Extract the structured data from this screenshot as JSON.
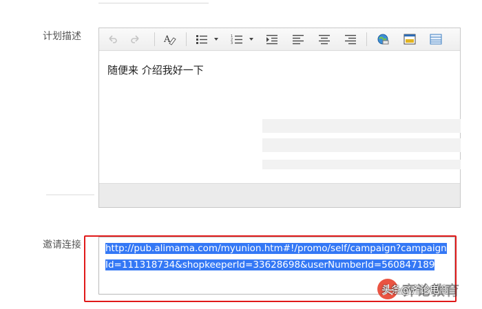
{
  "form": {
    "plan_description_label": "计划描述",
    "invite_link_label": "邀请连接"
  },
  "editor": {
    "toolbar": [
      {
        "name": "undo-icon"
      },
      {
        "name": "redo-icon"
      },
      {
        "name": "clear-format-icon"
      },
      {
        "name": "bulleted-list-icon"
      },
      {
        "name": "numbered-list-icon"
      },
      {
        "name": "indent-icon"
      },
      {
        "name": "align-left-icon"
      },
      {
        "name": "align-center-icon"
      },
      {
        "name": "align-right-icon"
      },
      {
        "name": "insert-link-icon"
      },
      {
        "name": "insert-image-icon"
      },
      {
        "name": "insert-table-icon"
      }
    ],
    "content": "随便来 介绍我好一下"
  },
  "invite": {
    "url": "http://pub.alimama.com/myunion.htm#!/promo/self/campaign?campaignId=111318734&shopkeeperId=33628698&userNumberId=560847189",
    "highlight_color": "#e01818",
    "selection_color": "#3478f5"
  },
  "watermark": {
    "logo_text": "头",
    "source_text": "头条",
    "brand_text": "齐论教育",
    "sub_text": "@齐论电商"
  }
}
